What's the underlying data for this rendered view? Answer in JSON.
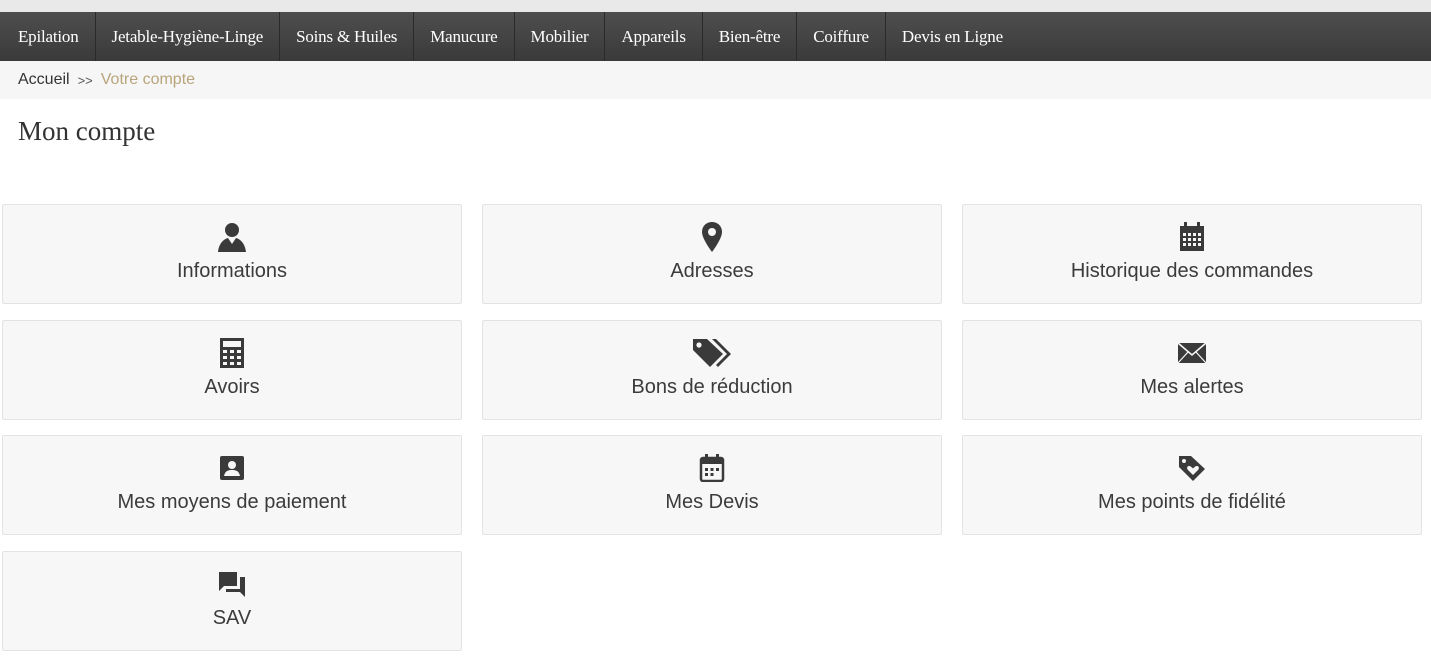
{
  "nav": {
    "items": [
      {
        "label": "Epilation"
      },
      {
        "label": "Jetable-Hygiène-Linge"
      },
      {
        "label": "Soins & Huiles"
      },
      {
        "label": "Manucure"
      },
      {
        "label": "Mobilier"
      },
      {
        "label": "Appareils"
      },
      {
        "label": "Bien-être"
      },
      {
        "label": "Coiffure"
      },
      {
        "label": "Devis en Ligne"
      }
    ]
  },
  "breadcrumb": {
    "home": "Accueil",
    "separator": ">>",
    "current": "Votre compte"
  },
  "page": {
    "title": "Mon compte"
  },
  "tiles": [
    {
      "label": "Informations",
      "icon": "user-icon"
    },
    {
      "label": "Adresses",
      "icon": "map-pin-icon"
    },
    {
      "label": "Historique des commandes",
      "icon": "calendar-grid-icon"
    },
    {
      "label": "Avoirs",
      "icon": "calculator-icon"
    },
    {
      "label": "Bons de réduction",
      "icon": "tags-icon"
    },
    {
      "label": "Mes alertes",
      "icon": "envelope-icon"
    },
    {
      "label": "Mes moyens de paiement",
      "icon": "account-box-icon"
    },
    {
      "label": "Mes Devis",
      "icon": "event-calendar-icon"
    },
    {
      "label": "Mes points de fidélité",
      "icon": "heart-tag-icon"
    },
    {
      "label": "SAV",
      "icon": "chat-bubbles-icon"
    }
  ],
  "colors": {
    "navbar": "#444444",
    "breadcrumb_current": "#b9a57c",
    "tile_background": "#f7f7f7",
    "icon": "#3a3a3a"
  }
}
